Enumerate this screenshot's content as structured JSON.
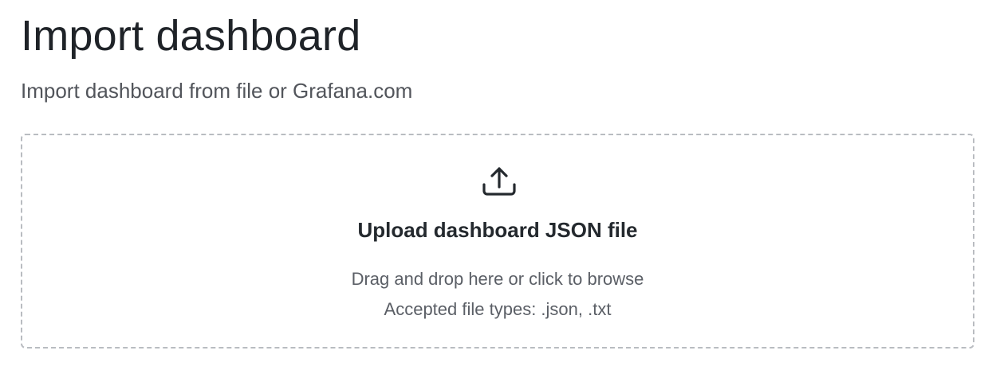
{
  "header": {
    "title": "Import dashboard",
    "subtitle": "Import dashboard from file or Grafana.com"
  },
  "upload": {
    "icon": "upload-icon",
    "title": "Upload dashboard JSON file",
    "hint": "Drag and drop here or click to browse",
    "accepted_types": "Accepted file types: .json, .txt"
  },
  "colors": {
    "text_primary": "#1f2328",
    "text_secondary": "#5b5f66",
    "dashed_border": "#b9bcc1"
  }
}
